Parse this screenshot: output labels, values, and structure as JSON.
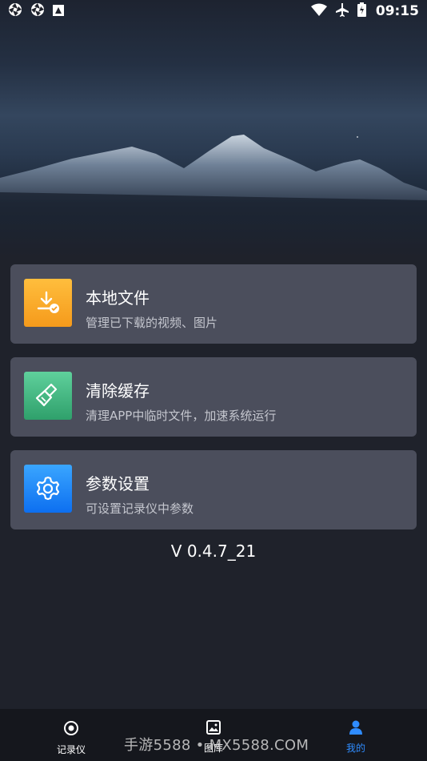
{
  "status_bar": {
    "time": "09:15",
    "icons": [
      "aperture-icon",
      "aperture-icon",
      "image-notification-icon",
      "wifi-icon",
      "airplane-icon",
      "battery-charging-icon"
    ]
  },
  "cards": [
    {
      "title": "本地文件",
      "subtitle": "管理已下载的视频、图片",
      "icon": "download-check-icon",
      "color": "#f5a623"
    },
    {
      "title": "清除缓存",
      "subtitle": "清理APP中临时文件，加速系统运行",
      "icon": "broom-icon",
      "color": "#3fb07f"
    },
    {
      "title": "参数设置",
      "subtitle": "可设置记录仪中参数",
      "icon": "gear-icon",
      "color": "#1e88f5"
    }
  ],
  "version": "V 0.4.7_21",
  "nav": {
    "items": [
      {
        "label": "记录仪",
        "icon": "camera-lens-icon",
        "active": false
      },
      {
        "label": "图库",
        "icon": "gallery-icon",
        "active": false
      },
      {
        "label": "我的",
        "icon": "person-icon",
        "active": true
      }
    ],
    "active_color": "#2f8cff"
  },
  "watermark": "手游5588 • MX5588.COM"
}
